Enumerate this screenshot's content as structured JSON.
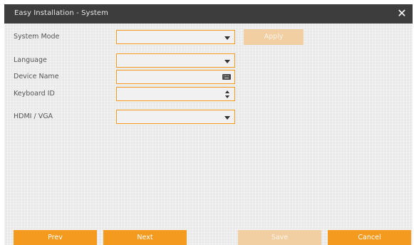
{
  "dialog": {
    "title": "Easy Installation - System",
    "close_symbol": "✕"
  },
  "form": {
    "system_mode": {
      "label": "System Mode",
      "value": ""
    },
    "apply_label": "Apply",
    "language": {
      "label": "Language",
      "value": ""
    },
    "device_name": {
      "label": "Device Name",
      "value": "",
      "icon": "keyboard-icon"
    },
    "keyboard_id": {
      "label": "Keyboard ID",
      "value": ""
    },
    "hdmi_vga": {
      "label": "HDMI / VGA",
      "value": ""
    }
  },
  "footer": {
    "prev_label": "Prev",
    "next_label": "Next",
    "save_label": "Save",
    "cancel_label": "Cancel"
  },
  "colors": {
    "accent": "#f39a1f",
    "accent_disabled": "#f1cfa3",
    "titlebar": "#3d3d3d",
    "panel": "#e9e9e9"
  }
}
